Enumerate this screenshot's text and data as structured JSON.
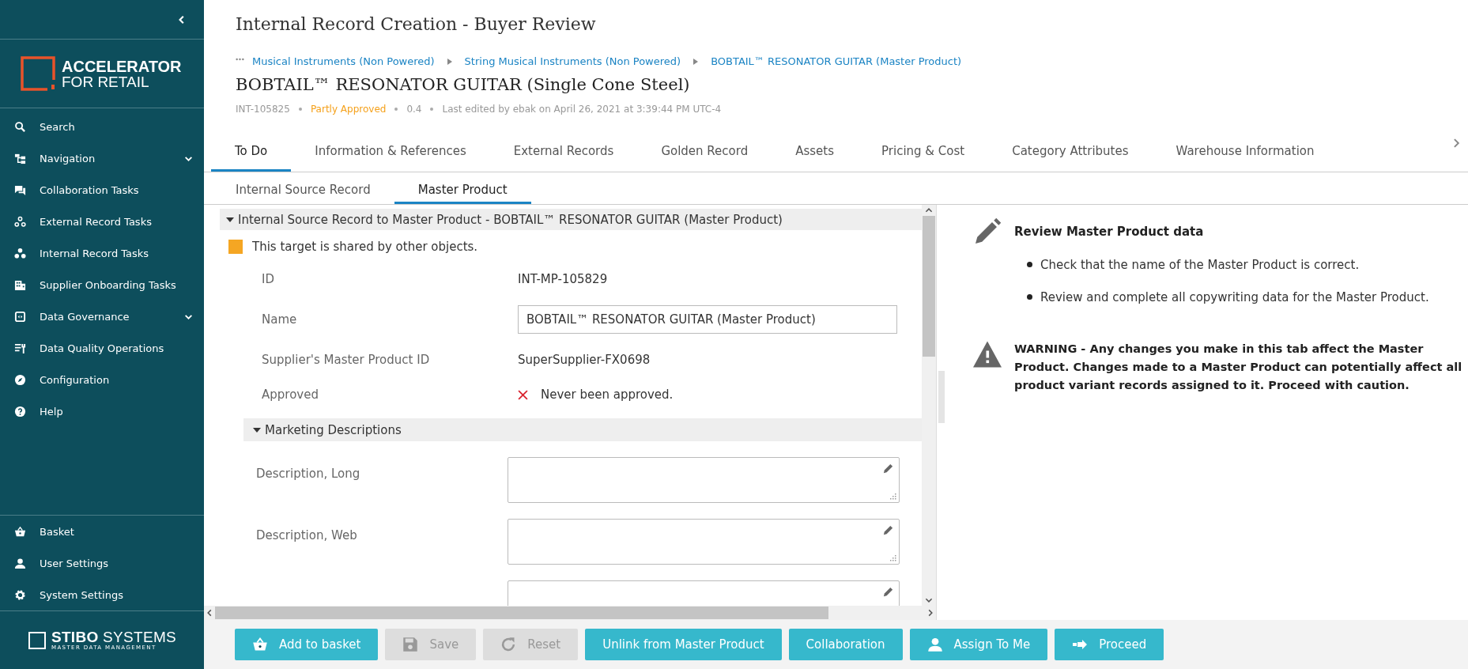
{
  "sidebar": {
    "logo": {
      "line_1": "ACCELERATOR",
      "line_2": "FOR RETAIL"
    },
    "items": [
      {
        "label": "Search",
        "has_submenu": false
      },
      {
        "label": "Navigation",
        "has_submenu": true
      },
      {
        "label": "Collaboration Tasks",
        "has_submenu": false
      },
      {
        "label": "External Record Tasks",
        "has_submenu": false
      },
      {
        "label": "Internal Record Tasks",
        "has_submenu": false
      },
      {
        "label": "Supplier Onboarding Tasks",
        "has_submenu": false
      },
      {
        "label": "Data Governance",
        "has_submenu": true
      },
      {
        "label": "Data Quality Operations",
        "has_submenu": false
      },
      {
        "label": "Configuration",
        "has_submenu": false
      },
      {
        "label": "Help",
        "has_submenu": false
      }
    ],
    "bottom_items": [
      {
        "label": "Basket"
      },
      {
        "label": "User Settings"
      },
      {
        "label": "System Settings"
      }
    ],
    "footer_logo": {
      "brand_bold": "STIBO",
      "brand": "SYSTEMS",
      "tagline": "MASTER DATA MANAGEMENT"
    }
  },
  "header": {
    "title": "Internal Record Creation - Buyer Review",
    "breadcrumbs": [
      "Musical Instruments (Non Powered)",
      "String Musical Instruments (Non Powered)",
      "BOBTAIL™ RESONATOR GUITAR (Master Product)"
    ],
    "product_title": "BOBTAIL™ RESONATOR GUITAR (Single Cone Steel)",
    "meta": {
      "id": "INT-105825",
      "status": "Partly Approved",
      "version": "0.4",
      "last_edited": "Last edited by ebak on April 26, 2021 at 3:39:44 PM UTC-4"
    }
  },
  "tabs": [
    {
      "label": "To Do",
      "selected": true
    },
    {
      "label": "Information & References",
      "selected": false
    },
    {
      "label": "External Records",
      "selected": false
    },
    {
      "label": "Golden Record",
      "selected": false
    },
    {
      "label": "Assets",
      "selected": false
    },
    {
      "label": "Pricing & Cost",
      "selected": false
    },
    {
      "label": "Category Attributes",
      "selected": false
    },
    {
      "label": "Warehouse Information",
      "selected": false
    }
  ],
  "subtabs": [
    {
      "label": "Internal Source Record",
      "selected": false
    },
    {
      "label": "Master Product",
      "selected": true
    }
  ],
  "section": {
    "title": "Internal Source Record to Master Product - BOBTAIL™ RESONATOR GUITAR (Master Product)",
    "expanded": true,
    "notice": {
      "text": "This target is shared by other objects.",
      "color": "#f5a623"
    },
    "fields": [
      {
        "label": "ID",
        "kind": "text",
        "value": "INT-MP-105829"
      },
      {
        "label": "Name",
        "kind": "input",
        "value": "BOBTAIL™ RESONATOR GUITAR (Master Product)"
      },
      {
        "label": "Supplier's Master Product ID",
        "kind": "text",
        "value": "SuperSupplier-FX0698"
      },
      {
        "label": "Approved",
        "kind": "status",
        "approved": false,
        "value": "Never been approved."
      }
    ],
    "subsection": {
      "title": "Marketing Descriptions",
      "expanded": true,
      "fields": [
        {
          "label": "Description, Long",
          "kind": "textarea"
        },
        {
          "label": "Description, Web",
          "kind": "textarea"
        },
        {
          "kind": "textarea"
        }
      ]
    }
  },
  "task": {
    "title": "Review Master Product data",
    "bullets": [
      "Check that the name of the Master Product is correct.",
      "Review and complete all copywriting data for the Master Product."
    ],
    "warning": "WARNING - Any changes you make in this tab affect the Master Product. Changes made to a Master Product can potentially affect all product variant records assigned to it. Proceed with caution."
  },
  "buttons": [
    {
      "label": "Add to basket",
      "disabled": false
    },
    {
      "label": "Save",
      "disabled": true
    },
    {
      "label": "Reset",
      "disabled": true
    },
    {
      "label": "Unlink from Master Product",
      "disabled": false
    },
    {
      "label": "Collaboration",
      "disabled": false
    },
    {
      "label": "Assign To Me",
      "disabled": false
    },
    {
      "label": "Proceed",
      "disabled": false
    }
  ]
}
